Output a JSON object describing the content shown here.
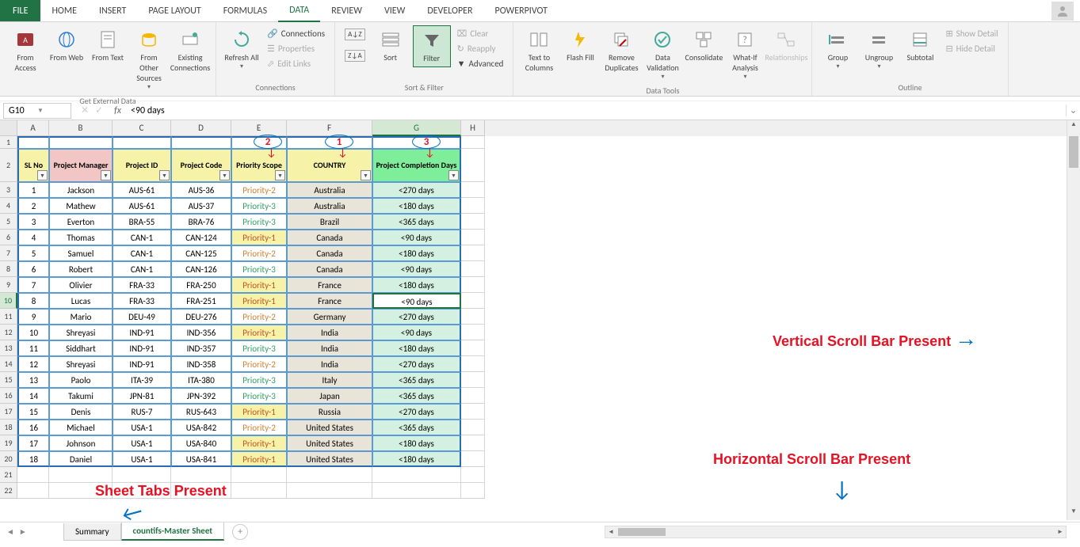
{
  "tabs": {
    "file": "FILE",
    "home": "HOME",
    "insert": "INSERT",
    "page": "PAGE LAYOUT",
    "formulas": "FORMULAS",
    "data": "DATA",
    "review": "REVIEW",
    "view": "VIEW",
    "developer": "DEVELOPER",
    "powerpivot": "POWERPIVOT"
  },
  "ribbon": {
    "ext_data": {
      "label": "Get External Data",
      "access": "From Access",
      "web": "From Web",
      "text": "From Text",
      "other": "From Other Sources",
      "existing": "Existing Connections"
    },
    "conn": {
      "label": "Connections",
      "refresh": "Refresh All",
      "connections": "Connections",
      "properties": "Properties",
      "edit": "Edit Links"
    },
    "sort": {
      "label": "Sort & Filter",
      "sort": "Sort",
      "filter": "Filter",
      "clear": "Clear",
      "reapply": "Reapply",
      "advanced": "Advanced"
    },
    "tools": {
      "label": "Data Tools",
      "ttc": "Text to Columns",
      "flash": "Flash Fill",
      "dup": "Remove Duplicates",
      "valid": "Data Validation",
      "consol": "Consolidate",
      "whatif": "What-If Analysis",
      "rel": "Relationships"
    },
    "outline": {
      "label": "Outline",
      "group": "Group",
      "ungroup": "Ungroup",
      "subtotal": "Subtotal",
      "show": "Show Detail",
      "hide": "Hide Detail"
    }
  },
  "namebox": "G10",
  "formula": "<90 days",
  "cols": [
    "A",
    "B",
    "C",
    "D",
    "E",
    "F",
    "G",
    "H"
  ],
  "headers": {
    "sl": "SL No",
    "pm": "Project Manager",
    "pid": "Project ID",
    "pcode": "Project Code",
    "scope": "Priority Scope",
    "country": "COUNTRY",
    "comp": "Project Completion Days"
  },
  "rows": [
    {
      "n": 1,
      "pm": "Jackson",
      "pid": "AUS-61",
      "code": "AUS-36",
      "pr": "Priority-2",
      "prc": "p2",
      "c": "Australia",
      "d": "<270 days"
    },
    {
      "n": 2,
      "pm": "Mathew",
      "pid": "AUS-61",
      "code": "AUS-37",
      "pr": "Priority-3",
      "prc": "p3",
      "c": "Australia",
      "d": "<180 days"
    },
    {
      "n": 3,
      "pm": "Everton",
      "pid": "BRA-55",
      "code": "BRA-76",
      "pr": "Priority-3",
      "prc": "p3",
      "c": "Brazil",
      "d": "<365 days"
    },
    {
      "n": 4,
      "pm": "Thomas",
      "pid": "CAN-1",
      "code": "CAN-124",
      "pr": "Priority-1",
      "prc": "p1",
      "c": "Canada",
      "d": "<90 days"
    },
    {
      "n": 5,
      "pm": "Samuel",
      "pid": "CAN-1",
      "code": "CAN-125",
      "pr": "Priority-2",
      "prc": "p2",
      "c": "Canada",
      "d": "<180 days"
    },
    {
      "n": 6,
      "pm": "Robert",
      "pid": "CAN-1",
      "code": "CAN-126",
      "pr": "Priority-3",
      "prc": "p3",
      "c": "Canada",
      "d": "<90 days"
    },
    {
      "n": 7,
      "pm": "Olivier",
      "pid": "FRA-33",
      "code": "FRA-250",
      "pr": "Priority-1",
      "prc": "p1",
      "c": "France",
      "d": "<180 days"
    },
    {
      "n": 8,
      "pm": "Lucas",
      "pid": "FRA-33",
      "code": "FRA-251",
      "pr": "Priority-1",
      "prc": "p1",
      "c": "France",
      "d": "<90 days"
    },
    {
      "n": 9,
      "pm": "Mario",
      "pid": "DEU-49",
      "code": "DEU-276",
      "pr": "Priority-2",
      "prc": "p2",
      "c": "Germany",
      "d": "<270 days"
    },
    {
      "n": 10,
      "pm": "Shreyasi",
      "pid": "IND-91",
      "code": "IND-356",
      "pr": "Priority-1",
      "prc": "p1",
      "c": "India",
      "d": "<90 days"
    },
    {
      "n": 11,
      "pm": "Siddhart",
      "pid": "IND-91",
      "code": "IND-357",
      "pr": "Priority-3",
      "prc": "p3",
      "c": "India",
      "d": "<180 days"
    },
    {
      "n": 12,
      "pm": "Shreyasi",
      "pid": "IND-91",
      "code": "IND-358",
      "pr": "Priority-2",
      "prc": "p2",
      "c": "India",
      "d": "<270 days"
    },
    {
      "n": 13,
      "pm": "Paolo",
      "pid": "ITA-39",
      "code": "ITA-380",
      "pr": "Priority-3",
      "prc": "p3",
      "c": "Italy",
      "d": "<365 days"
    },
    {
      "n": 14,
      "pm": "Takumi",
      "pid": "JPN-81",
      "code": "JPN-392",
      "pr": "Priority-3",
      "prc": "p3",
      "c": "Japan",
      "d": "<365 days"
    },
    {
      "n": 15,
      "pm": "Denis",
      "pid": "RUS-7",
      "code": "RUS-643",
      "pr": "Priority-1",
      "prc": "p1",
      "c": "Russia",
      "d": "<270 days"
    },
    {
      "n": 16,
      "pm": "Michael",
      "pid": "USA-1",
      "code": "USA-842",
      "pr": "Priority-2",
      "prc": "p2",
      "c": "United States",
      "d": "<365 days"
    },
    {
      "n": 17,
      "pm": "Johnson",
      "pid": "USA-1",
      "code": "USA-840",
      "pr": "Priority-1",
      "prc": "p1",
      "c": "United States",
      "d": "<180 days"
    },
    {
      "n": 18,
      "pm": "Daniel",
      "pid": "USA-1",
      "code": "USA-841",
      "pr": "Priority-1",
      "prc": "p1",
      "c": "United States",
      "d": "<180 days"
    }
  ],
  "sheets": {
    "summary": "Summary",
    "master": "countifs-Master Sheet"
  },
  "annot": {
    "vscroll": "Vertical Scroll Bar Present",
    "hscroll": "Horizontal Scroll Bar Present",
    "tabs": "Sheet Tabs Present",
    "n1": "1",
    "n2": "2",
    "n3": "3"
  }
}
